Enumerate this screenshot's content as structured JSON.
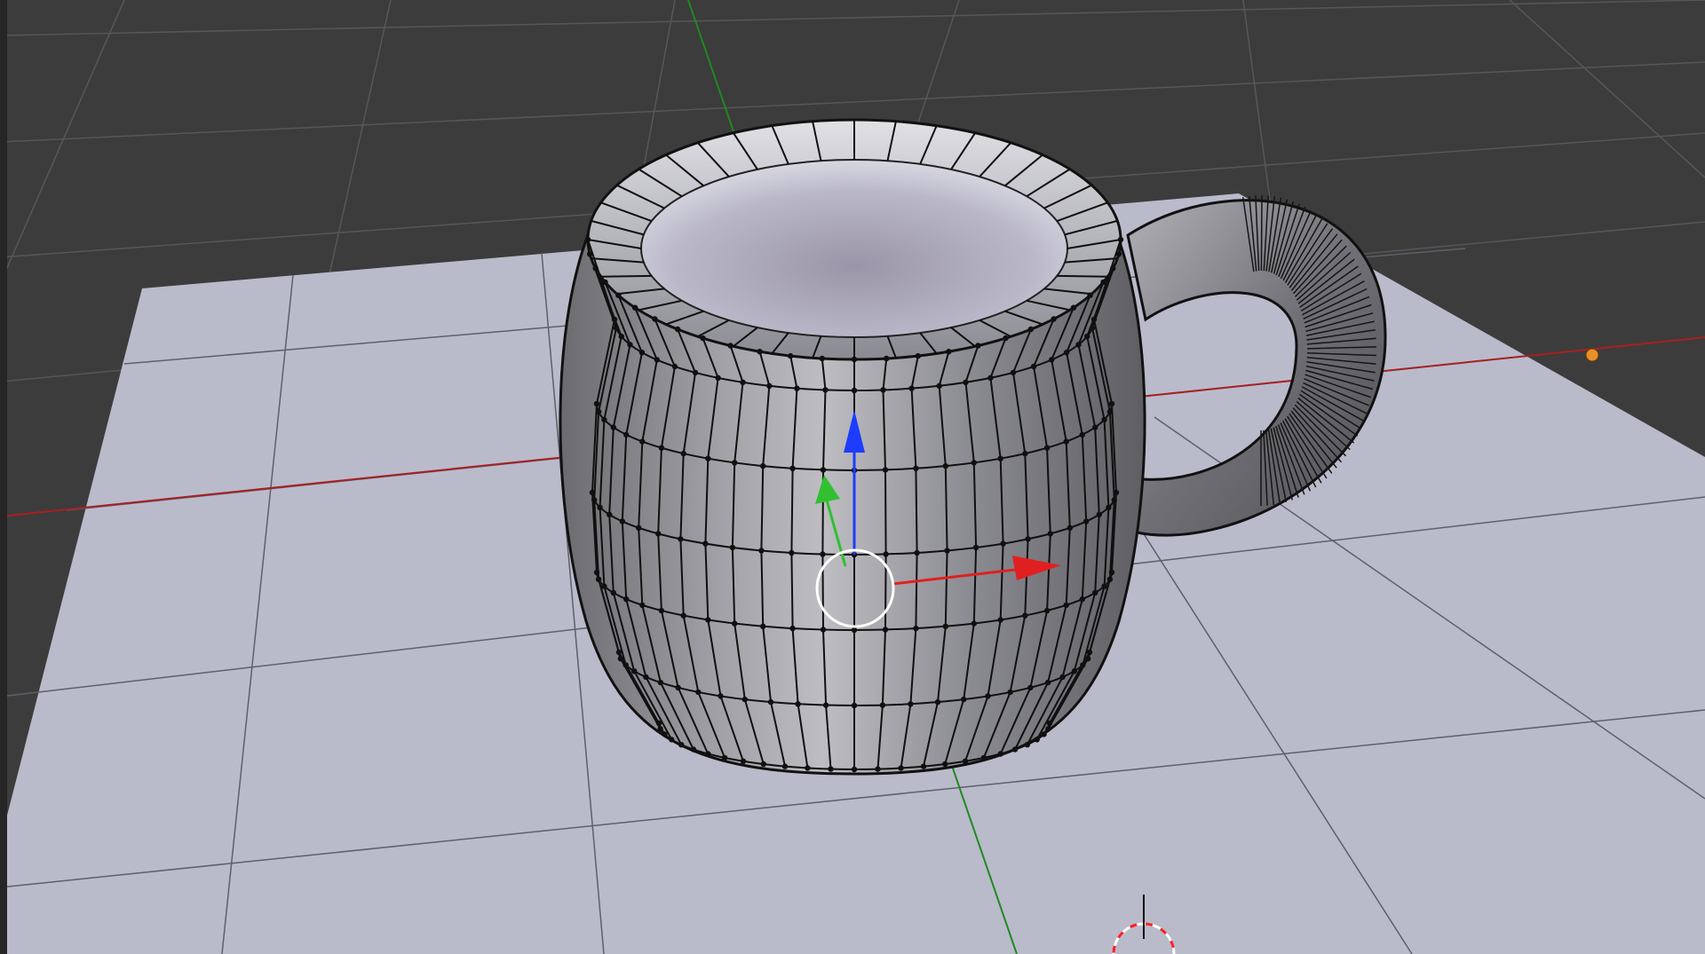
{
  "viewport": {
    "background": "#3c3c3c",
    "grid_color": "#555555",
    "ground_plane_color": "#b9bbcb",
    "axis_x_color": "#a82020",
    "axis_y_color": "#1f8a1f",
    "selected_vertex_color": "#e8902a"
  },
  "object": {
    "type": "mesh",
    "shape": "mug"
  },
  "gizmo": {
    "x_color": "#e02020",
    "y_color": "#30c030",
    "z_color": "#1e3cff",
    "center_color": "#ffffff"
  },
  "cursor": {
    "ring_colors": [
      "#ff2020",
      "#ffffff"
    ]
  }
}
